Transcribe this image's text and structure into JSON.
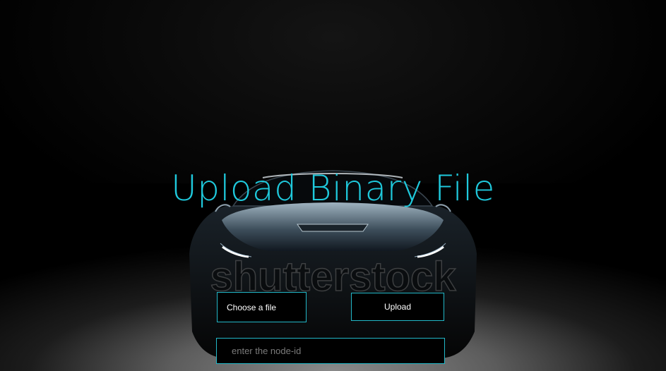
{
  "page": {
    "title": "Upload Binary File",
    "watermark_text": "shutterstock"
  },
  "form": {
    "choose_file_label": "Choose a file",
    "upload_label": "Upload",
    "node_id_placeholder": "enter the node-id",
    "node_id_value": ""
  },
  "colors": {
    "accent": "#1fc9dc",
    "border": "#22b8c8",
    "background": "#000000"
  }
}
